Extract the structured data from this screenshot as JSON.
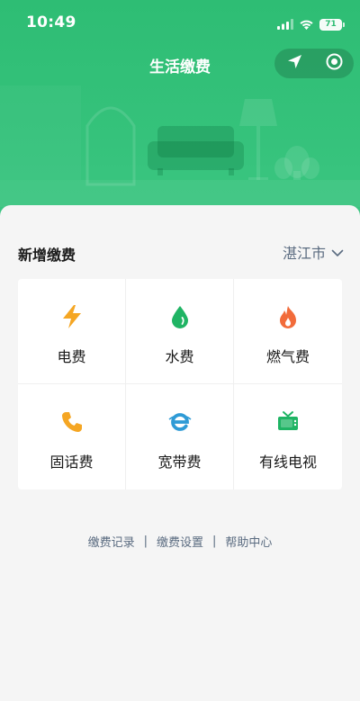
{
  "status_bar": {
    "time": "10:49",
    "battery": "71",
    "icons": [
      "signal-icon",
      "wifi-icon",
      "battery-icon"
    ]
  },
  "nav": {
    "title": "生活缴费",
    "capsule_icons": [
      "location-arrow-icon",
      "target-icon"
    ]
  },
  "section": {
    "title": "新增缴费",
    "city": "湛江市"
  },
  "services": [
    {
      "label": "电费",
      "icon": "lightning-icon",
      "color": "#f5a623"
    },
    {
      "label": "水费",
      "icon": "water-drop-icon",
      "color": "#1fb464"
    },
    {
      "label": "燃气费",
      "icon": "flame-icon",
      "color": "#f26b3a"
    },
    {
      "label": "固话费",
      "icon": "phone-icon",
      "color": "#f5a623"
    },
    {
      "label": "宽带费",
      "icon": "broadband-e-icon",
      "color": "#2f9bd6"
    },
    {
      "label": "有线电视",
      "icon": "tv-icon",
      "color": "#1fb464"
    }
  ],
  "footer": {
    "links": [
      "缴费记录",
      "缴费设置",
      "帮助中心"
    ],
    "separator": "|"
  },
  "colors": {
    "header_green": "#2ebd74",
    "link_gray": "#5a6b80"
  }
}
